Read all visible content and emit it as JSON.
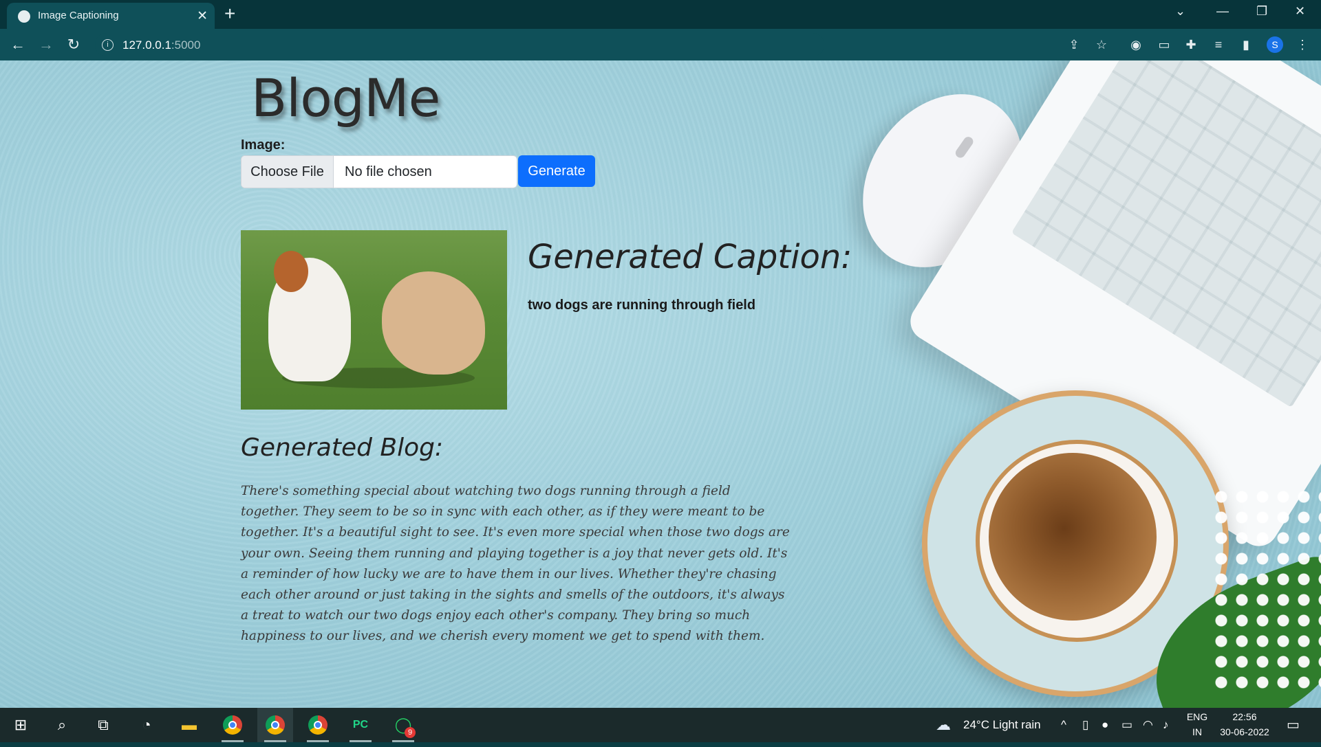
{
  "browser": {
    "tab_title": "Image Captioning",
    "tab_close": "✕",
    "new_tab": "+",
    "url_host": "127.0.0.1",
    "url_port": ":5000"
  },
  "page": {
    "brand": "BlogMe",
    "image_label": "Image:",
    "choose_file": "Choose File",
    "file_status": "No file chosen",
    "generate": "Generate",
    "caption_heading": "Generated Caption:",
    "caption_text": "two dogs are running through field",
    "blog_heading": "Generated Blog:",
    "blog_text": "There's something special about watching two dogs running through a field together. They seem to be so in sync with each other, as if they were meant to be together. It's a beautiful sight to see. It's even more special when those two dogs are your own. Seeing them running and playing together is a joy that never gets old. It's a reminder of how lucky we are to have them in our lives. Whether they're chasing each other around or just taking in the sights and smells of the outdoors, it's always a treat to watch our two dogs enjoy each other's company. They bring so much happiness to our lives, and we cherish every moment we get to spend with them."
  },
  "taskbar": {
    "weather": "24°C  Light rain",
    "lang": "ENG",
    "region": "IN",
    "time": "22:56",
    "date": "30-06-2022",
    "whatsapp_badge": "9",
    "profile_initial": "S"
  }
}
